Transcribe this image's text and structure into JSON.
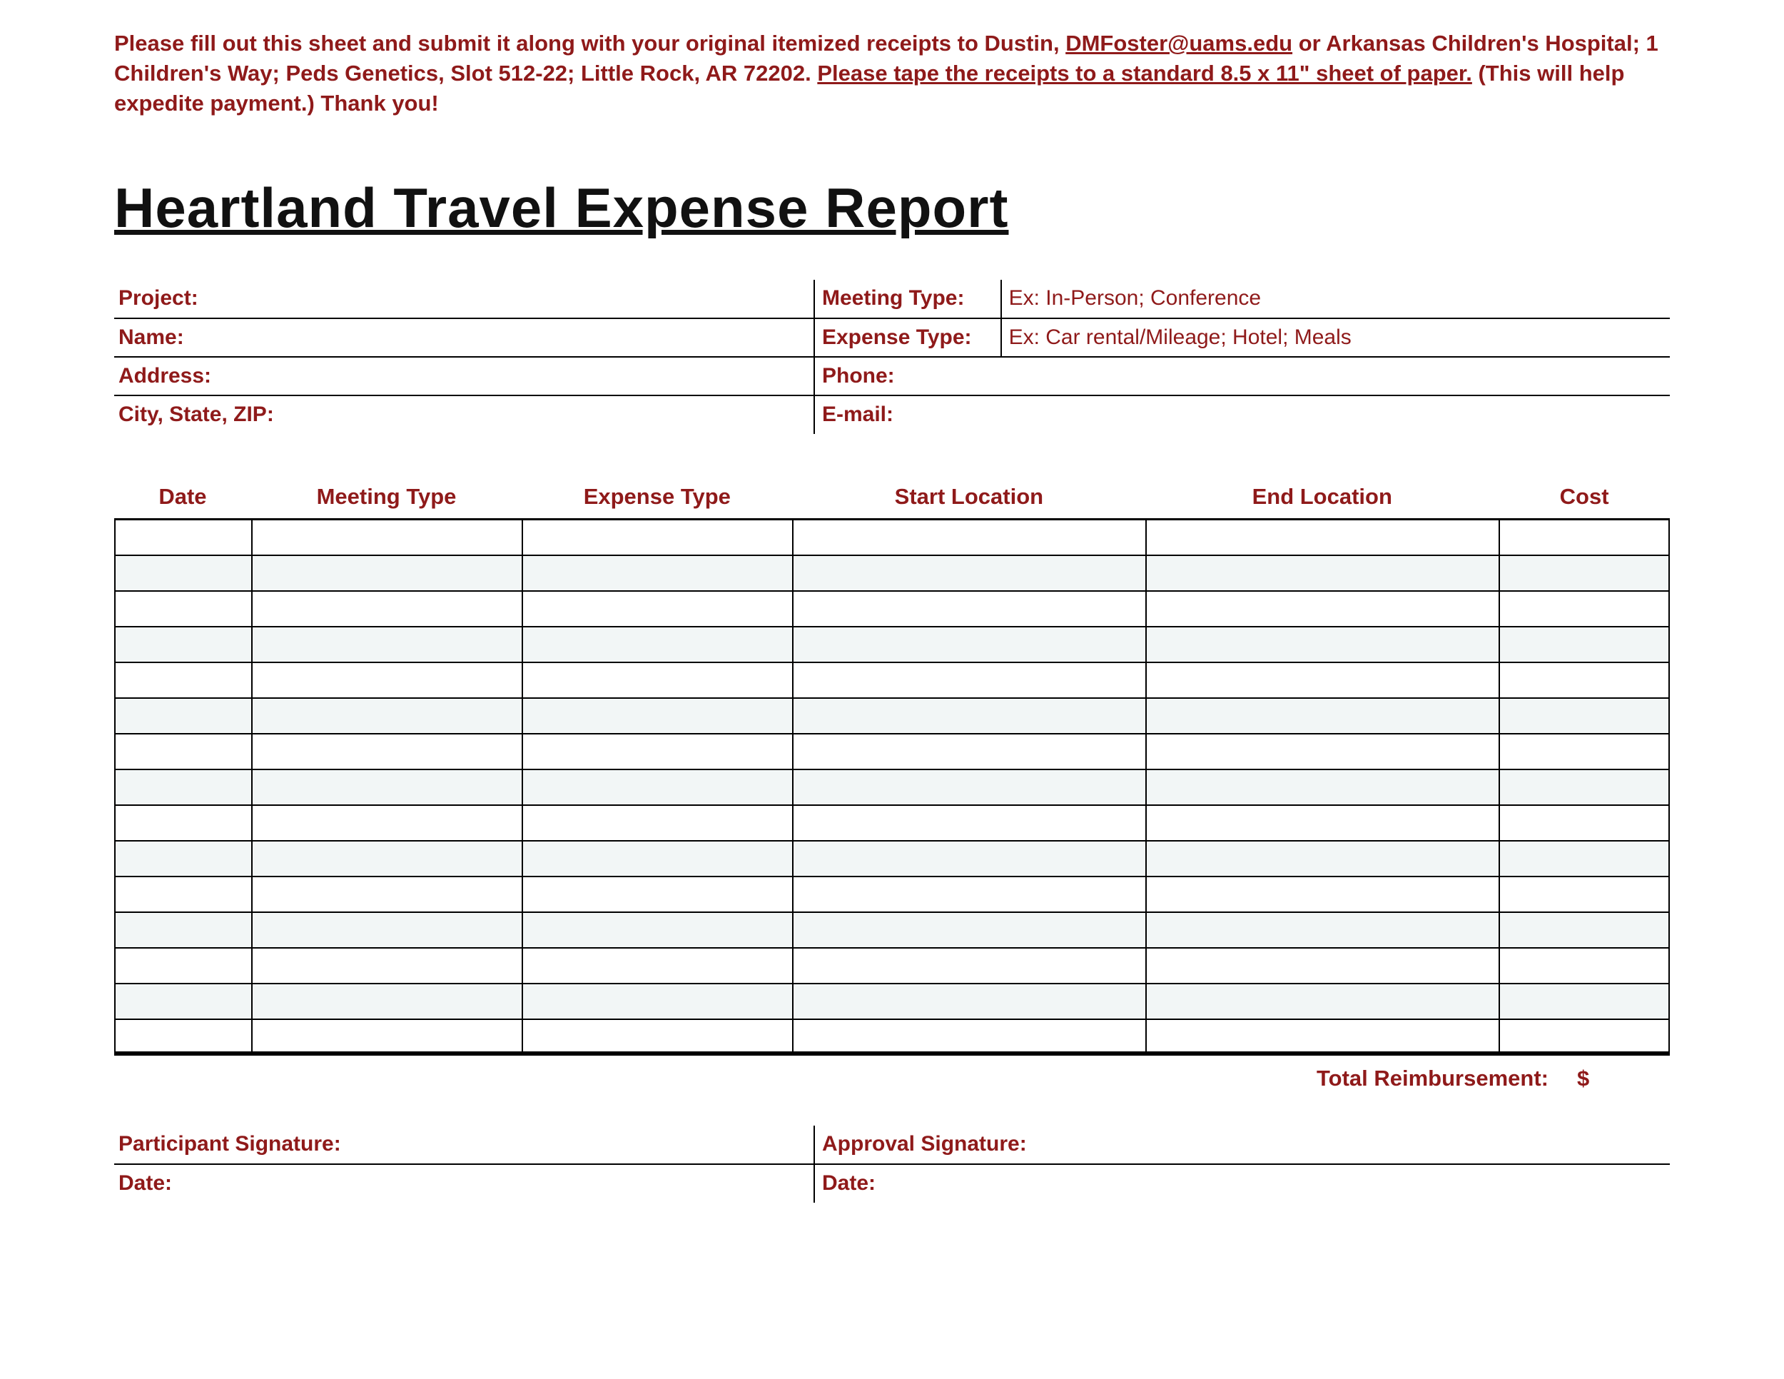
{
  "instructions": {
    "pre": "Please fill out this sheet and submit it along with your original itemized receipts to Dustin, ",
    "email": "DMFoster@uams.edu",
    "mid": " or Arkansas Children's Hospital; 1 Children's Way; Peds Genetics, Slot 512-22; Little Rock, AR 72202.  ",
    "underline": "Please tape the receipts to a standard 8.5 x 11\" sheet of paper.",
    "post": " (This will help expedite payment.)   Thank you!"
  },
  "title": "Heartland Travel Expense Report",
  "info": {
    "left": [
      {
        "label": "Project:",
        "value": ""
      },
      {
        "label": "Name:",
        "value": ""
      },
      {
        "label": "Address:",
        "value": ""
      },
      {
        "label": "City, State, ZIP:",
        "value": ""
      }
    ],
    "right": [
      {
        "label": "Meeting Type:",
        "value": "Ex: In-Person; Conference"
      },
      {
        "label": "Expense Type:",
        "value": "Ex: Car rental/Mileage; Hotel; Meals"
      },
      {
        "label": "Phone:",
        "value": ""
      },
      {
        "label": "E-mail:",
        "value": ""
      }
    ]
  },
  "grid": {
    "headers": [
      "Date",
      "Meeting Type",
      "Expense Type",
      "Start Location",
      "End Location",
      "Cost"
    ],
    "row_count": 15
  },
  "total": {
    "label": "Total Reimbursement:",
    "symbol": "$"
  },
  "signatures": {
    "left": [
      {
        "label": "Participant Signature:"
      },
      {
        "label": "Date:"
      }
    ],
    "right": [
      {
        "label": "Approval Signature:"
      },
      {
        "label": "Date:"
      }
    ]
  }
}
